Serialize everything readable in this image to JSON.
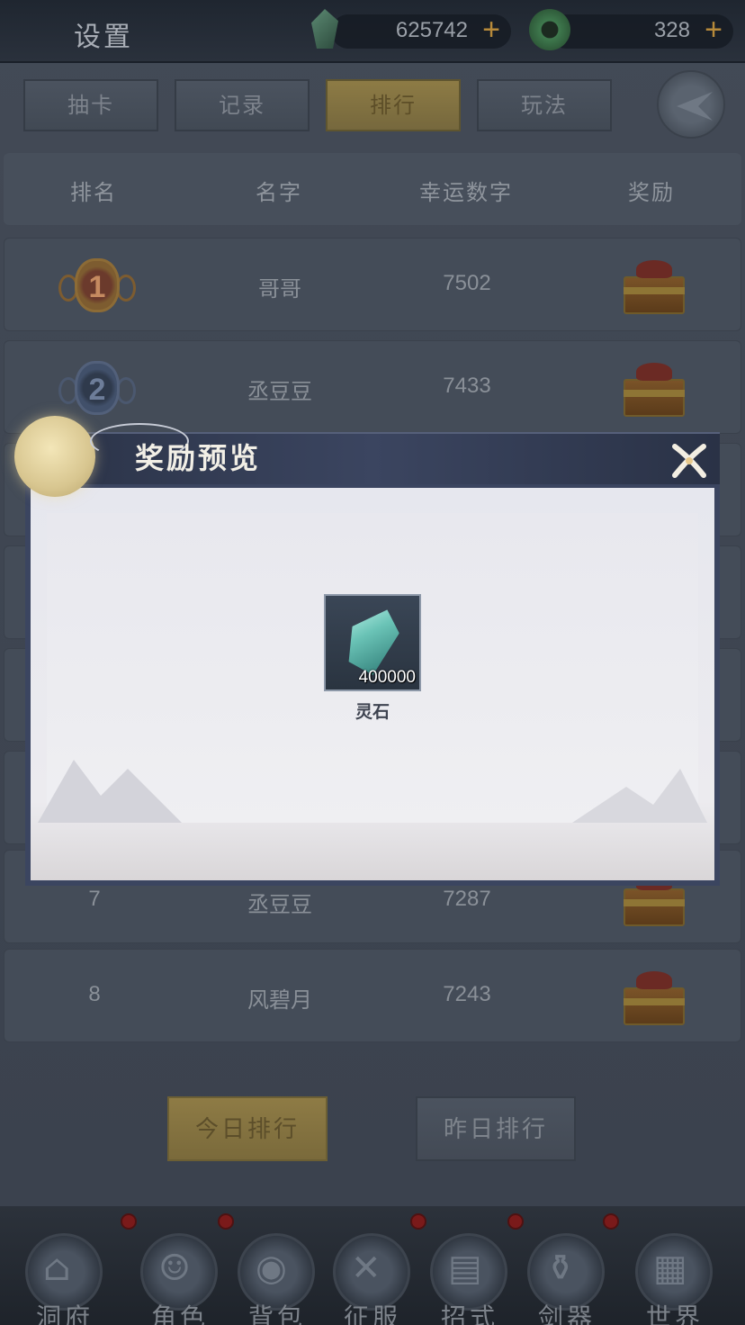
{
  "topbar": {
    "title": "设置",
    "currency1_value": "625742",
    "currency2_value": "328",
    "plus": "+"
  },
  "tabs": [
    {
      "label": "抽卡"
    },
    {
      "label": "记录"
    },
    {
      "label": "排行"
    },
    {
      "label": "玩法"
    }
  ],
  "table": {
    "headers": [
      "排名",
      "名字",
      "幸运数字",
      "奖励"
    ],
    "rows": [
      {
        "rank": "1",
        "name": "哥哥",
        "number": "7502"
      },
      {
        "rank": "2",
        "name": "丞豆豆",
        "number": "7433"
      },
      {
        "rank": "7",
        "name": "丞豆豆",
        "number": "7287"
      },
      {
        "rank": "8",
        "name": "风碧月",
        "number": "7243"
      }
    ]
  },
  "buttons": {
    "today": "今日排行",
    "yesterday": "昨日排行"
  },
  "nav": [
    {
      "label": "洞府"
    },
    {
      "label": "角色"
    },
    {
      "label": "背包"
    },
    {
      "label": "征服"
    },
    {
      "label": "招式"
    },
    {
      "label": "剑器"
    },
    {
      "label": "世界"
    }
  ],
  "modal": {
    "title": "奖励预览",
    "item": {
      "quantity": "400000",
      "name": "灵石"
    }
  },
  "colors": {
    "accent_gold": "#8e7b45",
    "badge_red": "#7a1a1a",
    "modal_header": "#3b4560"
  }
}
